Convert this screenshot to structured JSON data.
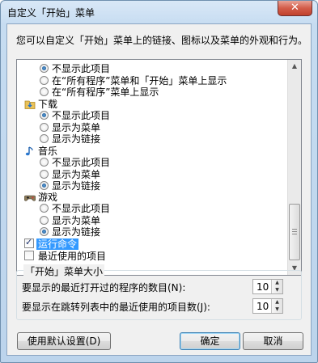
{
  "window": {
    "title": "自定义「开始」菜单",
    "close_glyph": "✕"
  },
  "description": "您可以自定义「开始」菜单上的链接、图标以及菜单的外观和行为。",
  "list": {
    "top_options": [
      {
        "label": "不显示此项目",
        "selected": true
      },
      {
        "label": "在“所有程序”菜单和「开始」菜单上显示",
        "selected": false
      },
      {
        "label": "在“所有程序”菜单上显示",
        "selected": false
      }
    ],
    "groups": [
      {
        "name": "下载",
        "icon": "download-folder-icon",
        "options": [
          {
            "label": "不显示此项目",
            "selected": true
          },
          {
            "label": "显示为菜单",
            "selected": false
          },
          {
            "label": "显示为链接",
            "selected": false
          }
        ]
      },
      {
        "name": "音乐",
        "icon": "music-note-icon",
        "options": [
          {
            "label": "不显示此项目",
            "selected": false
          },
          {
            "label": "显示为菜单",
            "selected": false
          },
          {
            "label": "显示为链接",
            "selected": true
          }
        ]
      },
      {
        "name": "游戏",
        "icon": "games-icon",
        "options": [
          {
            "label": "不显示此项目",
            "selected": false
          },
          {
            "label": "显示为菜单",
            "selected": false
          },
          {
            "label": "显示为链接",
            "selected": true
          }
        ]
      }
    ],
    "checkboxes": [
      {
        "label": "运行命令",
        "checked": true,
        "highlighted": true
      },
      {
        "label": "最近使用的项目",
        "checked": false,
        "highlighted": false
      }
    ]
  },
  "size_group": {
    "title": "「开始」菜单大小",
    "recent_programs_label": "要显示的最近打开过的程序的数目(N):",
    "recent_programs_value": "10",
    "jumplist_items_label": "要显示在跳转列表中的最近使用的项目数(J):",
    "jumplist_items_value": "10"
  },
  "buttons": {
    "defaults": "使用默认设置(D)",
    "ok": "确定",
    "cancel": "取消"
  }
}
